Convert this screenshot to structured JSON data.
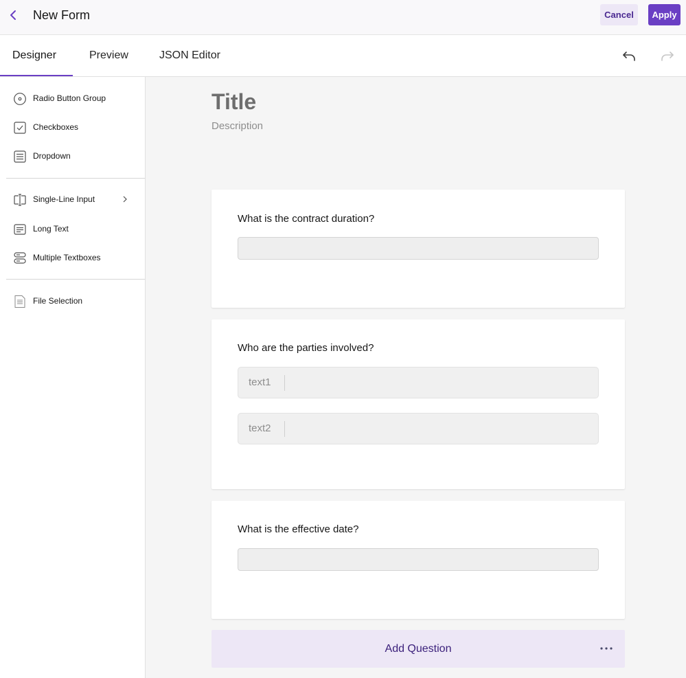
{
  "header": {
    "title": "New Form",
    "cancel_label": "Cancel",
    "apply_label": "Apply",
    "back_icon": "chevron-left-icon"
  },
  "tabs": [
    {
      "label": "Designer",
      "active": true
    },
    {
      "label": "Preview",
      "active": false
    },
    {
      "label": "JSON Editor",
      "active": false
    }
  ],
  "toolbar": {
    "undo_icon": "undo-icon",
    "redo_icon": "redo-icon",
    "redo_disabled": true
  },
  "sidebar": {
    "groups": [
      [
        {
          "label": "Radio Button Group",
          "icon": "radio-icon"
        },
        {
          "label": "Checkboxes",
          "icon": "checkbox-icon"
        },
        {
          "label": "Dropdown",
          "icon": "dropdown-list-icon"
        }
      ],
      [
        {
          "label": "Single-Line Input",
          "icon": "text-cursor-icon",
          "has_submenu": true
        },
        {
          "label": "Long Text",
          "icon": "long-text-icon"
        },
        {
          "label": "Multiple Textboxes",
          "icon": "multiple-textboxes-icon"
        }
      ],
      [
        {
          "label": "File Selection",
          "icon": "file-icon"
        }
      ]
    ]
  },
  "form": {
    "title": "Title",
    "description": "Description",
    "questions": [
      {
        "label": "What is the contract duration?",
        "type": "text"
      },
      {
        "label": "Who are the parties involved?",
        "type": "multipletext",
        "items": [
          "text1",
          "text2"
        ]
      },
      {
        "label": "What is the effective date?",
        "type": "text"
      }
    ],
    "add_question_label": "Add Question"
  },
  "colors": {
    "accent": "#6a3fc4",
    "accent_light": "#ede7f6",
    "accent_dark": "#3a1f7a",
    "canvas_bg": "#f5f5f5"
  }
}
